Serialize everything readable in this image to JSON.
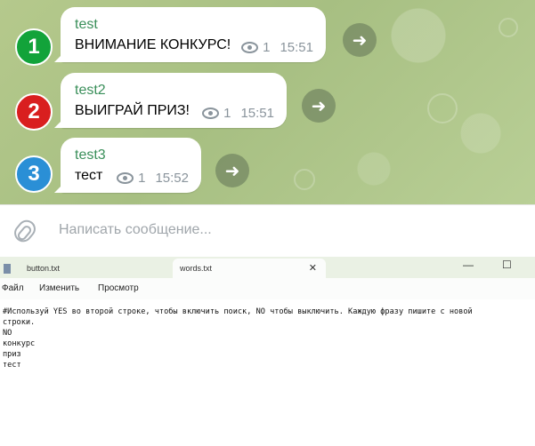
{
  "chat": {
    "messages": [
      {
        "badge": "1",
        "badge_color": "#12a33a",
        "sender": "test",
        "text": "ВНИМАНИЕ КОНКУРС!",
        "views": "1",
        "time": "15:51"
      },
      {
        "badge": "2",
        "badge_color": "#d91f1f",
        "sender": "test2",
        "text": "ВЫИГРАЙ ПРИЗ!",
        "views": "1",
        "time": "15:51"
      },
      {
        "badge": "3",
        "badge_color": "#2a8fd6",
        "sender": "test3",
        "text": "тест",
        "views": "1",
        "time": "15:52"
      }
    ],
    "composer_placeholder": "Написать сообщение..."
  },
  "notepad": {
    "tabs": [
      {
        "label": "button.txt"
      },
      {
        "label": "words.txt"
      }
    ],
    "window_controls": {
      "minimize": "—",
      "maximize": "☐",
      "close": "✕"
    },
    "tab_close": "✕",
    "menu": [
      "Файл",
      "Изменить",
      "Просмотр"
    ],
    "lines": [
      "#Используй YES во второй строке, чтобы включить поиск, NO чтобы выключить. Каждую фразу пишите с новой",
      "строки.",
      "NO",
      "конкурс",
      "приз",
      "тест"
    ]
  },
  "icons": {
    "eye": "eye-icon",
    "forward": "forward-arrow-icon",
    "attach": "paperclip-icon"
  }
}
